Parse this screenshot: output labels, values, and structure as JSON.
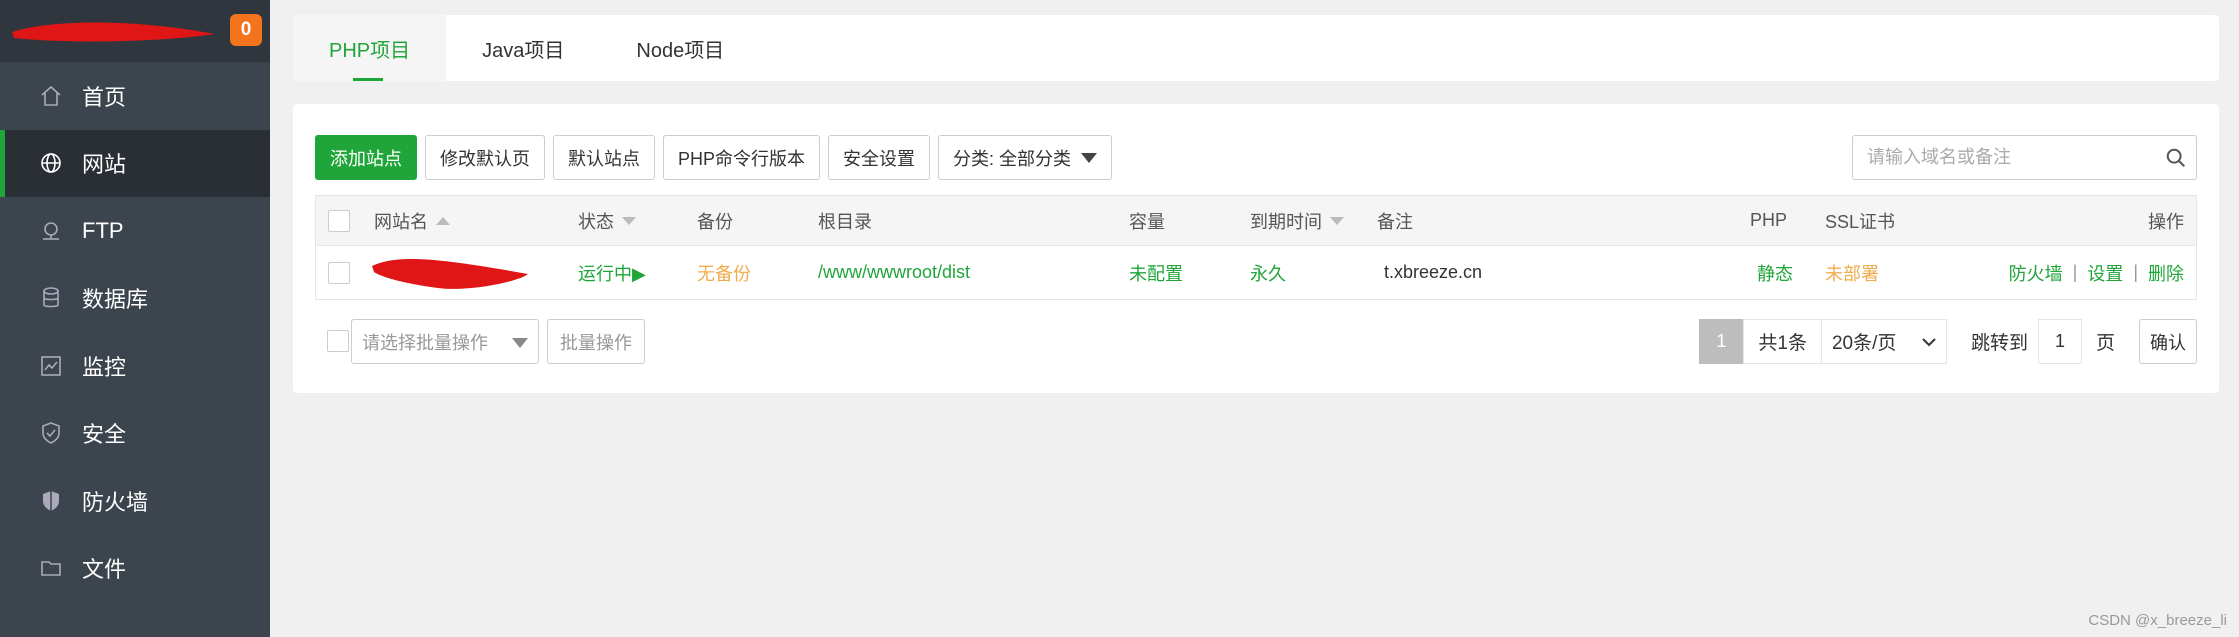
{
  "sidebar": {
    "badge": "0",
    "items": [
      {
        "label": "首页",
        "icon": "home-icon"
      },
      {
        "label": "网站",
        "icon": "globe-icon",
        "active": true
      },
      {
        "label": "FTP",
        "icon": "ftp-icon"
      },
      {
        "label": "数据库",
        "icon": "database-icon"
      },
      {
        "label": "监控",
        "icon": "monitor-icon"
      },
      {
        "label": "安全",
        "icon": "shield-icon"
      },
      {
        "label": "防火墙",
        "icon": "firewall-icon"
      },
      {
        "label": "文件",
        "icon": "folder-icon"
      }
    ]
  },
  "tabs": [
    {
      "label": "PHP项目",
      "active": true
    },
    {
      "label": "Java项目"
    },
    {
      "label": "Node项目"
    }
  ],
  "toolbar": {
    "add_site": "添加站点",
    "modify_default_page": "修改默认页",
    "default_site": "默认站点",
    "php_cli_version": "PHP命令行版本",
    "security_settings": "安全设置",
    "category": "分类: 全部分类"
  },
  "search": {
    "placeholder": "请输入域名或备注"
  },
  "table": {
    "headers": {
      "site_name": "网站名",
      "status": "状态",
      "backup": "备份",
      "root_dir": "根目录",
      "capacity": "容量",
      "expiry": "到期时间",
      "remark": "备注",
      "php": "PHP",
      "ssl": "SSL证书",
      "actions": "操作"
    },
    "rows": [
      {
        "status": "运行中▶",
        "backup": "无备份",
        "root_dir": "/www/wwwroot/dist",
        "capacity": "未配置",
        "expiry": "永久",
        "remark": "t.xbreeze.cn",
        "php": "静态",
        "ssl": "未部署",
        "actions": {
          "firewall": "防火墙",
          "settings": "设置",
          "delete": "删除"
        }
      }
    ]
  },
  "footer": {
    "batch_placeholder": "请选择批量操作",
    "batch_button": "批量操作",
    "current_page": "1",
    "total": "共1条",
    "page_size": "20条/页",
    "jump_label": "跳转到",
    "jump_value": "1",
    "jump_unit": "页",
    "confirm": "确认"
  },
  "watermark": "CSDN @x_breeze_li",
  "colors": {
    "accent": "#20a53a",
    "warning": "#f0ad4e",
    "sidebar": "#3c444d"
  }
}
